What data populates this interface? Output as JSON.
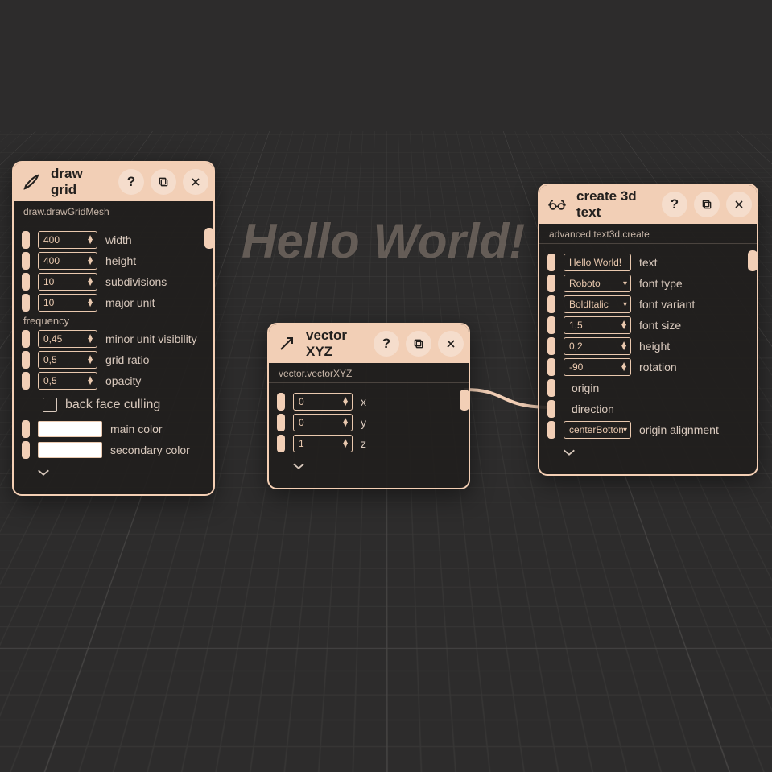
{
  "scene_text": "Hello World!",
  "nodes": {
    "grid": {
      "title": "draw grid",
      "path": "draw.drawGridMesh",
      "width": "400",
      "height": "400",
      "subdivisions": "10",
      "major_unit": "10",
      "minor_vis": "0,45",
      "grid_ratio": "0,5",
      "opacity": "0,5",
      "labels": {
        "width": "width",
        "height": "height",
        "subdivisions": "subdivisions",
        "major_unit": "major unit",
        "frequency": "frequency",
        "minor_vis": "minor unit visibility",
        "grid_ratio": "grid ratio",
        "opacity": "opacity",
        "back_cull": "back face culling",
        "main_color": "main color",
        "secondary_color": "secondary color"
      }
    },
    "vec": {
      "title": "vector XYZ",
      "path": "vector.vectorXYZ",
      "x": "0",
      "y": "0",
      "z": "1",
      "labels": {
        "x": "x",
        "y": "y",
        "z": "z"
      }
    },
    "text3d": {
      "title": "create 3d text",
      "path": "advanced.text3d.create",
      "text": "Hello World!",
      "font_type": "Roboto",
      "font_variant": "BoldItalic",
      "font_size": "1,5",
      "height_val": "0,2",
      "rotation": "-90",
      "origin_align": "centerBottom",
      "labels": {
        "text": "text",
        "font_type": "font type",
        "font_variant": "font variant",
        "font_size": "font size",
        "height": "height",
        "rotation": "rotation",
        "origin": "origin",
        "direction": "direction",
        "origin_align": "origin alignment"
      }
    }
  },
  "buttons": {
    "help": "?",
    "close": "✕"
  }
}
